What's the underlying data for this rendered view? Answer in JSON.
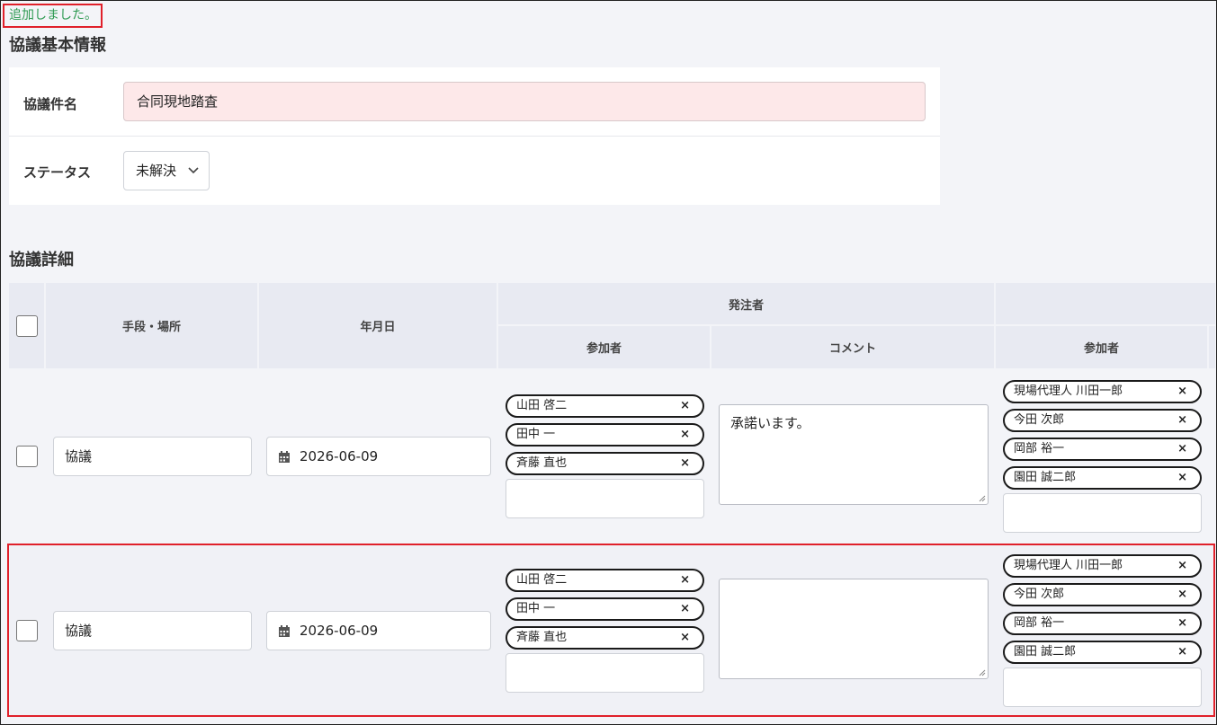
{
  "flash_message": "追加しました。",
  "basic_section": {
    "heading": "協議基本情報",
    "title_label": "協議件名",
    "title_value": "合同現地踏査",
    "status_label": "ステータス",
    "status_value": "未解決"
  },
  "detail_section": {
    "heading": "協議詳細",
    "columns": {
      "method_place": "手段・場所",
      "date": "年月日",
      "orderer_group": "発注者",
      "participants": "参加者",
      "comment": "コメント",
      "contractor_participants": "参加者"
    },
    "rows": [
      {
        "method": "協議",
        "date": "2026-06-09",
        "orderer_participants": [
          "山田 啓二",
          "田中 一",
          "斉藤 直也"
        ],
        "comment": "承諾います。",
        "contractor_participants": [
          "現場代理人 川田一郎",
          "今田 次郎",
          "岡部 裕一",
          "園田 誠二郎"
        ]
      },
      {
        "method": "協議",
        "date": "2026-06-09",
        "orderer_participants": [
          "山田 啓二",
          "田中 一",
          "斉藤 直也"
        ],
        "comment": "",
        "contractor_participants": [
          "現場代理人 川田一郎",
          "今田 次郎",
          "岡部 裕一",
          "園田 誠二郎"
        ]
      }
    ]
  },
  "icons": {
    "chip_remove": "×",
    "calendar": "calendar-icon",
    "select_arrow": "chevron-down-icon"
  },
  "colors": {
    "flash_text": "#2e9a52",
    "highlight_border": "#e0202a",
    "required_field_bg": "#fde8e9"
  }
}
